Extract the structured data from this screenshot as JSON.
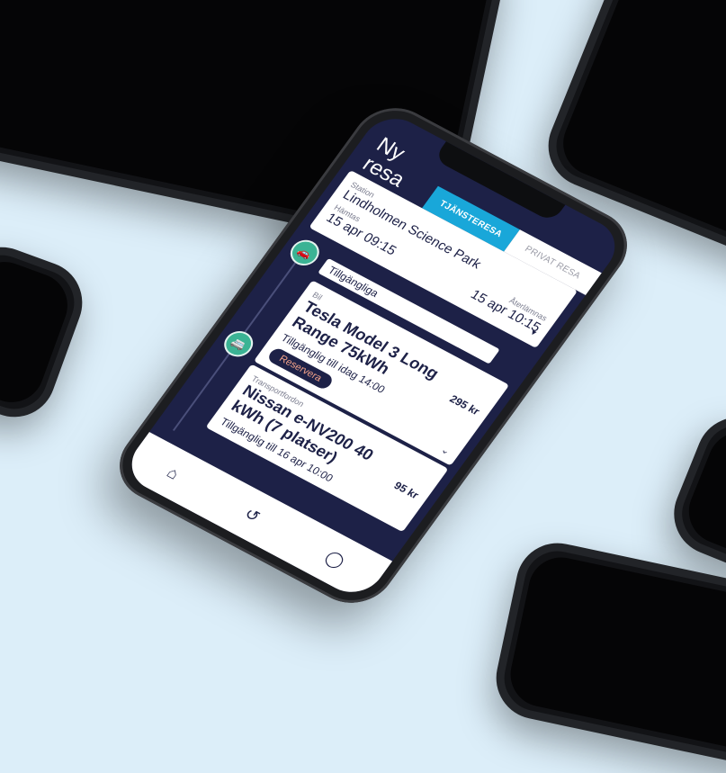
{
  "header": {
    "title_line1": "Ny",
    "title_line2": "resa"
  },
  "tabs": [
    {
      "label": "TJÄNSTERESA",
      "active": true
    },
    {
      "label": "PRIVAT RESA",
      "active": false
    }
  ],
  "form": {
    "station_label": "Station",
    "station_value": "Lindholmen Science Park",
    "pickup_label": "Hämtas",
    "pickup_value": "15 apr 09:15",
    "return_label": "Återlämnas",
    "return_value": "15 apr 10:15"
  },
  "section_label": "Tillgängliga",
  "cards": [
    {
      "type": "Bil",
      "name": "Tesla Model 3 Long Range 75kWh",
      "price": "295 kr",
      "availability": "Tillgänglig till idag 14:00",
      "button": "Reservera"
    },
    {
      "type": "Transportfordon",
      "name": "Nissan e-NV200 40 kWh (7 platser)",
      "price": "95 kr",
      "availability": "Tillgänglig till 16 apr 10:00"
    }
  ],
  "icons": {
    "node_car": "car-icon",
    "node_van": "van-icon",
    "nav_home": "home-icon",
    "nav_history": "history-icon",
    "nav_profile": "profile-icon"
  },
  "colors": {
    "background": "#dceef9",
    "app_navy": "#1d2147",
    "tab_active": "#19a7d9",
    "node_green": "#3bb394",
    "reserve_text": "#f4a38a"
  }
}
